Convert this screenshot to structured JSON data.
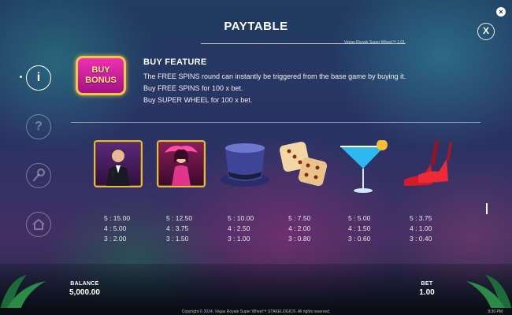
{
  "window": {
    "close_symbol": "×"
  },
  "paytable": {
    "title": "PAYTABLE",
    "subtitle": "Vegas Royale Super Wheel™ 1.01",
    "close_label": "X"
  },
  "sidebar": {
    "items": [
      {
        "name": "info",
        "icon": "info-icon",
        "glyph": "i",
        "active": true
      },
      {
        "name": "help",
        "icon": "question-icon",
        "glyph": "?",
        "active": false
      },
      {
        "name": "settings",
        "icon": "wrench-icon",
        "glyph": "🔧",
        "active": false
      },
      {
        "name": "home",
        "icon": "home-icon",
        "glyph": "⌂",
        "active": false
      }
    ]
  },
  "buy_feature": {
    "badge_line1": "BUY",
    "badge_line2": "BONUS",
    "heading": "BUY FEATURE",
    "line1": "The FREE SPINS round can instantly be triggered from the base game by buying it.",
    "line2": "Buy FREE SPINS for 100 x bet.",
    "line3": "Buy SUPER WHEEL for 100 x bet."
  },
  "symbols": [
    {
      "icon": "singer-man-icon",
      "p5": "5 : 15.00",
      "p4": "4 : 5.00",
      "p3": "3 : 2.00"
    },
    {
      "icon": "showgirl-icon",
      "p5": "5 : 12.50",
      "p4": "4 : 3.75",
      "p3": "3 : 1.50"
    },
    {
      "icon": "top-hat-icon",
      "p5": "5 : 10.00",
      "p4": "4 : 2.50",
      "p3": "3 : 1.00"
    },
    {
      "icon": "dice-icon",
      "p5": "5 : 7.50",
      "p4": "4 : 2.00",
      "p3": "3 : 0.80"
    },
    {
      "icon": "cocktail-icon",
      "p5": "5 : 5.00",
      "p4": "4 : 1.50",
      "p3": "3 : 0.60"
    },
    {
      "icon": "red-heels-icon",
      "p5": "5 : 3.75",
      "p4": "4 : 1.00",
      "p3": "3 : 0.40"
    }
  ],
  "bottom": {
    "balance_label": "BALANCE",
    "balance_value": "5,000.00",
    "bet_label": "BET",
    "bet_value": "1.00"
  },
  "footer": {
    "copyright": "Copyright © 2024, Vegas Royale Super Wheel™ STAKELOGIC®. All rights reserved.",
    "time": "9:30 PM"
  },
  "colors": {
    "accent_gold": "#e6b84a",
    "badge_pink": "#f02fb4",
    "text": "#ffffff"
  }
}
